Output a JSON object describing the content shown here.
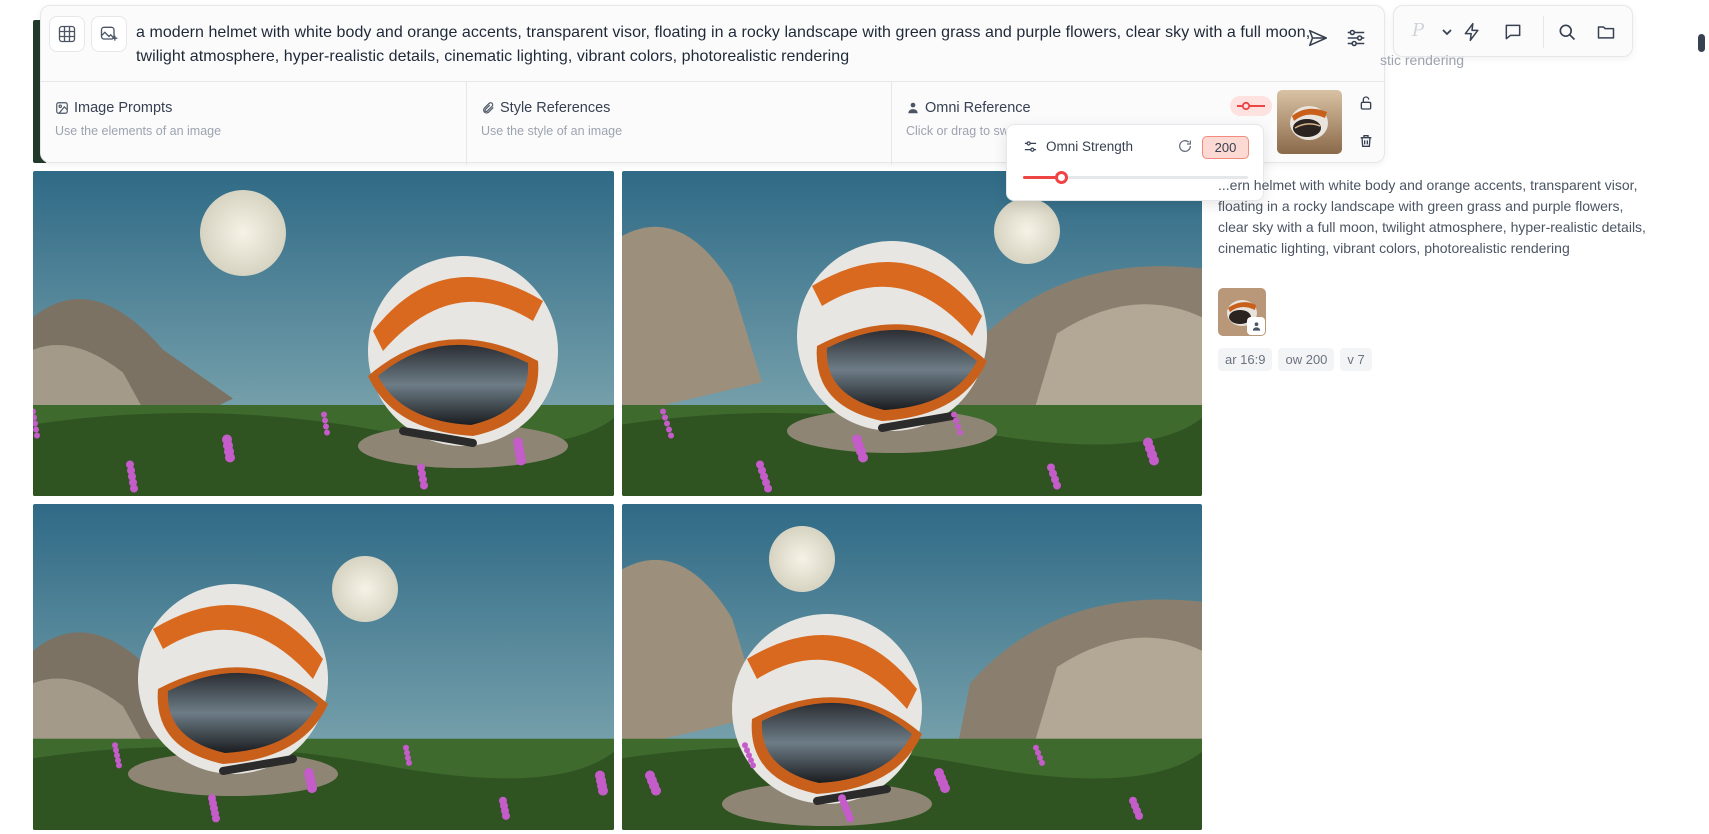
{
  "prompt": {
    "text": "a modern helmet with white body and orange accents, transparent visor, floating in a rocky landscape with green grass and purple flowers, clear sky with a full moon, twilight atmosphere, hyper-realistic details, cinematic lighting, vibrant colors, photorealistic rendering"
  },
  "references": {
    "image_prompts": {
      "title": "Image Prompts",
      "subtitle": "Use the elements of an image"
    },
    "style_references": {
      "title": "Style References",
      "subtitle": "Use the style of an image"
    },
    "omni_reference": {
      "title": "Omni Reference",
      "subtitle": "Click or drag to sw"
    }
  },
  "omni_strength": {
    "label": "Omni Strength",
    "value": "200",
    "slider_fraction": 0.17
  },
  "detail": {
    "clipped_text": "stic rendering",
    "prompt": "...ern helmet with white body and orange accents, transparent visor, floating in a rocky landscape with green grass and purple flowers, clear sky with a full moon, twilight atmosphere, hyper-realistic details, cinematic lighting, vibrant colors, photorealistic rendering",
    "tags": [
      "ar 16:9",
      "ow 200",
      "v 7"
    ]
  },
  "toolbar": {
    "personalize_glyph": "P"
  },
  "colors": {
    "accent": "#ef4444",
    "accent_soft": "#fdd9d4",
    "helmet_orange": "#d9691f"
  },
  "icons": [
    "grid-icon",
    "image-add-icon",
    "send-icon",
    "sliders-icon",
    "image-icon",
    "paperclip-icon",
    "person-icon",
    "lock-icon",
    "trash-icon",
    "reset-icon",
    "lightning-icon",
    "chat-icon",
    "search-icon",
    "folder-icon",
    "chevron-down-icon"
  ]
}
